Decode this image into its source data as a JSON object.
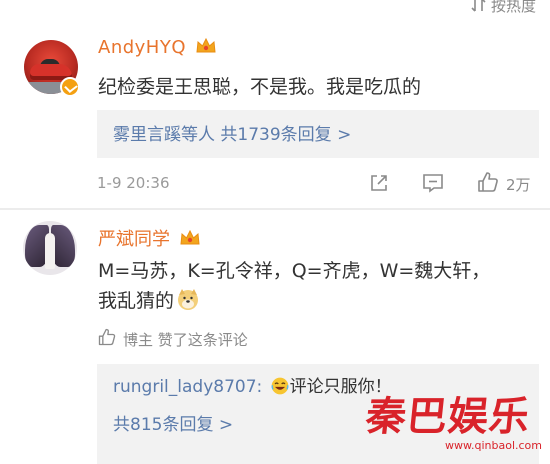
{
  "sort_bar": {
    "icon": "sort-icon",
    "label": "按热度"
  },
  "comment1": {
    "username": "AndyHYQ",
    "badge_icon": "crown-icon",
    "verified_icon": "verified-badge-icon",
    "text": "纪检委是王思聪，不是我。我是吃瓜的",
    "replies_summary": "雾里言蹊等人  共1739条回复 >",
    "timestamp": "1-9 20:36",
    "like_count": "2万"
  },
  "comment2": {
    "username": "严斌同学",
    "badge_icon": "crown-icon",
    "text_line1": "M=马苏，K=孔令祥，Q=齐虎，W=魏大轩，",
    "text_line2": "我乱猜的",
    "emoji": "doge-emoji",
    "author_liked": "博主 赞了这条评论",
    "reply": {
      "author": "rungril_lady8707:",
      "emoji": "laughing-emoji",
      "text": "评论只服你！"
    },
    "reply_count": "共815条回复 >"
  },
  "watermark": {
    "logo": "秦巴娱乐",
    "url": "www.qinbaol.com"
  },
  "colors": {
    "accent": "#e8742d",
    "link": "#5b7bab",
    "watermark": "#d9232a",
    "muted": "#9a9a9a"
  }
}
